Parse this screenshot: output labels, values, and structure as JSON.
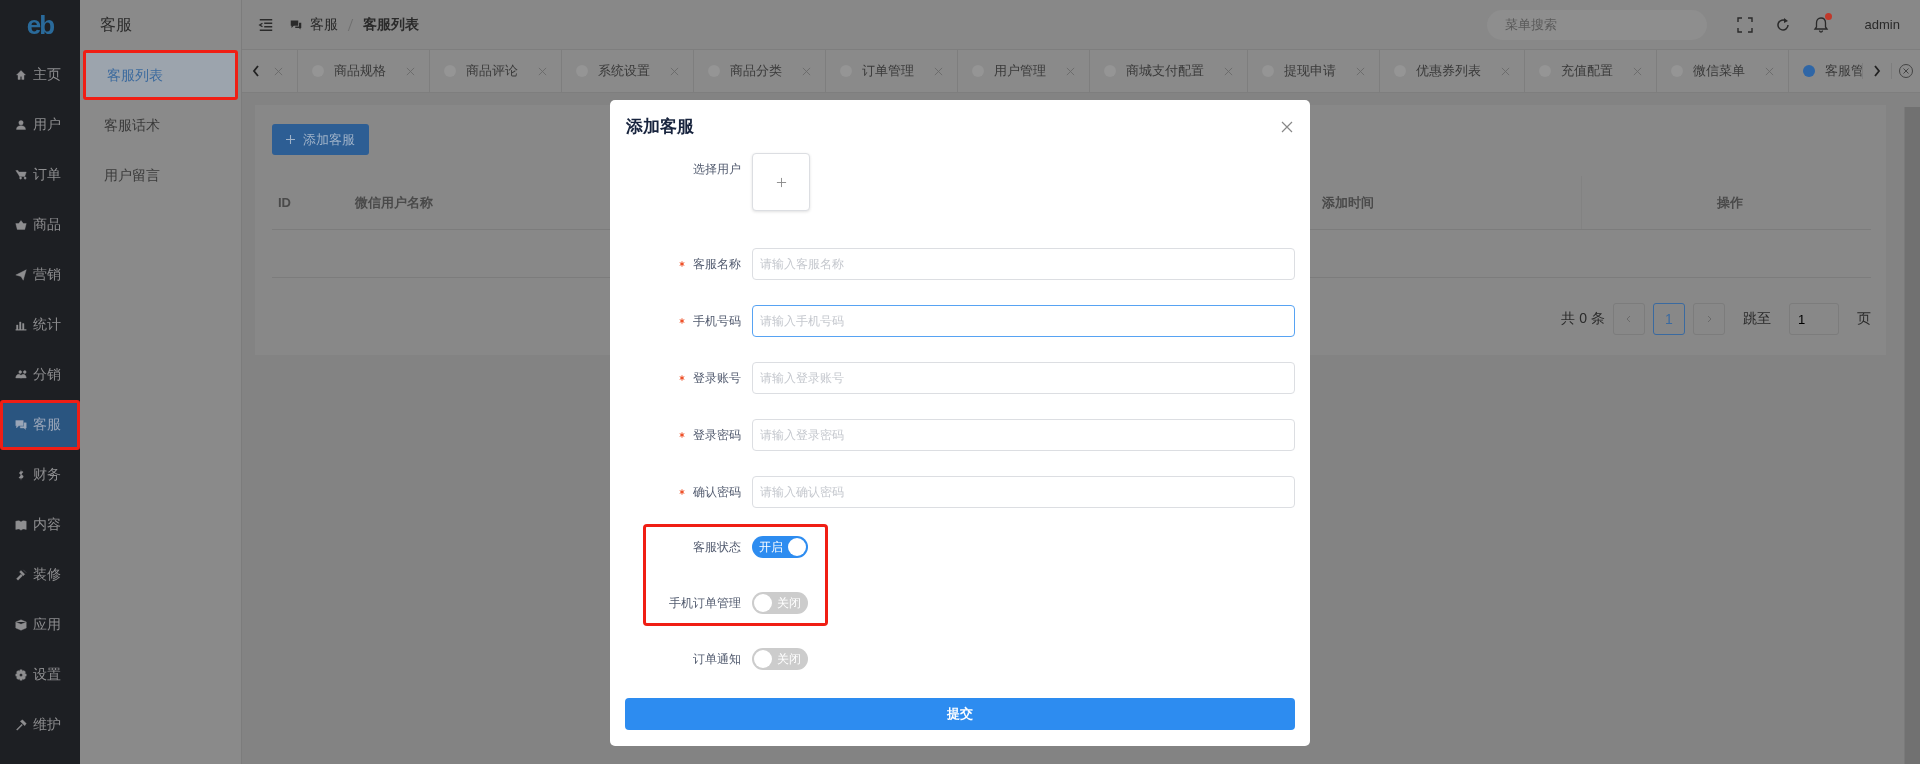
{
  "sidebar": {
    "logo": "eb",
    "items": [
      {
        "label": "主页",
        "selected": false,
        "highlighted": false
      },
      {
        "label": "用户",
        "selected": false,
        "highlighted": false
      },
      {
        "label": "订单",
        "selected": false,
        "highlighted": false
      },
      {
        "label": "商品",
        "selected": false,
        "highlighted": false
      },
      {
        "label": "营销",
        "selected": false,
        "highlighted": false
      },
      {
        "label": "统计",
        "selected": false,
        "highlighted": false
      },
      {
        "label": "分销",
        "selected": false,
        "highlighted": false
      },
      {
        "label": "客服",
        "selected": true,
        "highlighted": true
      },
      {
        "label": "财务",
        "selected": false,
        "highlighted": false
      },
      {
        "label": "内容",
        "selected": false,
        "highlighted": false
      },
      {
        "label": "装修",
        "selected": false,
        "highlighted": false
      },
      {
        "label": "应用",
        "selected": false,
        "highlighted": false
      },
      {
        "label": "设置",
        "selected": false,
        "highlighted": false
      },
      {
        "label": "维护",
        "selected": false,
        "highlighted": false
      }
    ]
  },
  "submenu": {
    "title": "客服",
    "items": [
      {
        "label": "客服列表",
        "selected": true,
        "highlighted": true
      },
      {
        "label": "客服话术",
        "selected": false,
        "highlighted": false
      },
      {
        "label": "用户留言",
        "selected": false,
        "highlighted": false
      }
    ]
  },
  "header": {
    "breadcrumb": [
      "客服",
      "客服列表"
    ],
    "search": {
      "placeholder": "菜单搜索"
    },
    "notification_dot": true,
    "user": "admin"
  },
  "tabs": [
    {
      "label": "商品规格",
      "selected": false
    },
    {
      "label": "商品评论",
      "selected": false
    },
    {
      "label": "系统设置",
      "selected": false
    },
    {
      "label": "商品分类",
      "selected": false
    },
    {
      "label": "订单管理",
      "selected": false
    },
    {
      "label": "用户管理",
      "selected": false
    },
    {
      "label": "商城支付配置",
      "selected": false
    },
    {
      "label": "提现申请",
      "selected": false
    },
    {
      "label": "优惠券列表",
      "selected": false
    },
    {
      "label": "充值配置",
      "selected": false
    },
    {
      "label": "微信菜单",
      "selected": false
    },
    {
      "label": "客服管",
      "selected": true
    }
  ],
  "page": {
    "add_button": "添加客服",
    "table": {
      "columns": [
        "ID",
        "微信用户名称",
        "添加时间",
        "操作"
      ]
    },
    "pagination": {
      "total": "共 0 条",
      "pages": [
        {
          "label": "1",
          "selected": true
        }
      ],
      "jump_label": "跳至",
      "jump_value": "1",
      "page_suffix": "页"
    }
  },
  "dialog": {
    "title": "添加客服",
    "user_picker": {
      "label": "选择用户"
    },
    "fields": [
      {
        "label": "客服名称",
        "required": true,
        "placeholder": "请输入客服名称",
        "focused": false
      },
      {
        "label": "手机号码",
        "required": true,
        "placeholder": "请输入手机号码",
        "focused": true
      },
      {
        "label": "登录账号",
        "required": true,
        "placeholder": "请输入登录账号",
        "focused": false
      },
      {
        "label": "登录密码",
        "required": true,
        "placeholder": "请输入登录密码",
        "focused": false
      },
      {
        "label": "确认密码",
        "required": true,
        "placeholder": "请输入确认密码",
        "focused": false
      }
    ],
    "switches": [
      {
        "label": "客服状态",
        "on": true,
        "text": "开启",
        "highlighted": true
      },
      {
        "label": "手机订单管理",
        "on": false,
        "text": "关闭",
        "highlighted": true
      },
      {
        "label": "订单通知",
        "on": false,
        "text": "关闭",
        "highlighted": false
      }
    ],
    "submit": "提交"
  }
}
